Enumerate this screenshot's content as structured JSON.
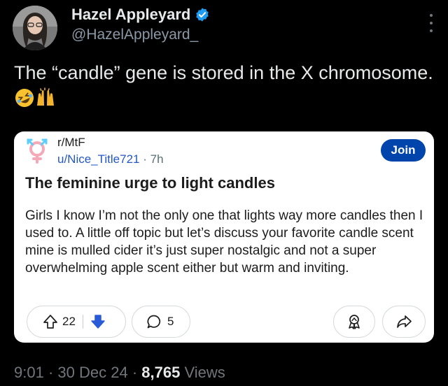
{
  "author": {
    "name": "Hazel Appleyard",
    "handle": "@HazelAppleyard_"
  },
  "tweet": {
    "text": "The “candle” gene is stored in the X chromosome.",
    "emojis": [
      "rolling-on-floor-laughing-emoji",
      "raising-hands-emoji"
    ]
  },
  "reddit_post": {
    "subreddit": "r/MtF",
    "username": "u/Nice_Title721",
    "separator": "·",
    "time": "7h",
    "join_label": "Join",
    "title": "The feminine urge to light candles",
    "body": "Girls I know I’m not the only one that lights way more candles then I used to. A little off topic but let’s discuss your favorite candle scent mine is mulled cider it’s just super nostalgic and not a super overwhelming apple scent either but warm and inviting.",
    "upvotes": "22",
    "comments": "5"
  },
  "footer": {
    "time": "9:01",
    "date": "30 Dec 24",
    "views_count": "8,765",
    "views_label": "Views",
    "separator": "·"
  },
  "colors": {
    "background": "#000000",
    "verified_blue": "#1d9bf0",
    "join_blue": "#0045ac",
    "downvote_blue": "#2a5bd7",
    "link_blue": "#2457c5"
  }
}
